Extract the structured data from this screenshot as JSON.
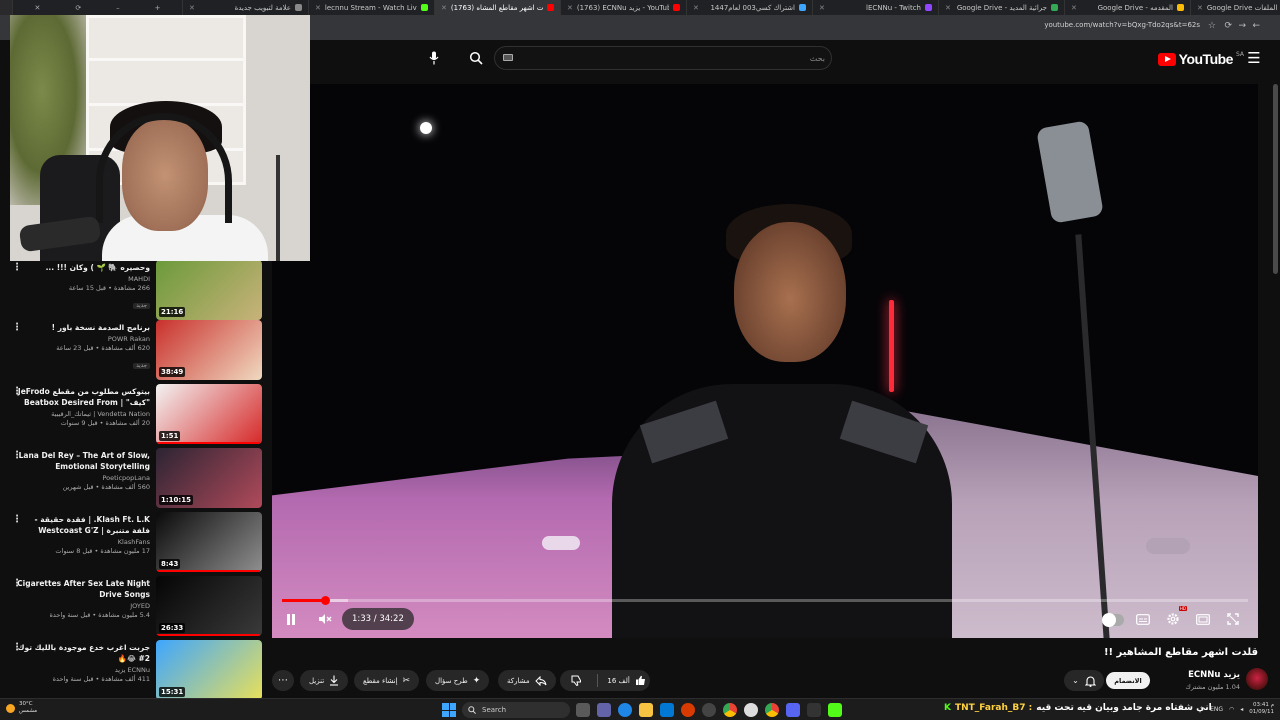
{
  "browser": {
    "tabs": [
      {
        "label": "علامة لتبويب جديدة",
        "color": "#888888"
      },
      {
        "label": "lecnnu Stream - Watch Live on",
        "color": "#53fc18"
      },
      {
        "label": "(1763) قلدت اشهر مقاطع المشاه",
        "color": "#ff0000",
        "active": true
      },
      {
        "label": "(1763) ECNNu يزيد - YouTube",
        "color": "#ff0000"
      },
      {
        "label": "اشتراك كسي003 لعام1447",
        "color": "#3ea6ff"
      },
      {
        "label": "lECNNu - Twitch",
        "color": "#9146ff"
      },
      {
        "label": "Google Drive - جرائية المديد",
        "color": "#34a853"
      },
      {
        "label": "Google Drive - المقدمه",
        "color": "#fbbc04"
      },
      {
        "label": "Google Drive مشاركة الملفات",
        "color": "#4285f4"
      }
    ],
    "url": "youtube.com/watch?v=bQxg-Tdo2qs&t=62s"
  },
  "header": {
    "logo_text": "YouTube",
    "logo_region": "SA",
    "search_placeholder": "بحث"
  },
  "player": {
    "current_time": "1:33",
    "duration": "34:22",
    "time_display": "1:33 / 34:22",
    "progress_fraction": 0.045,
    "buffered_fraction": 0.068
  },
  "video": {
    "title": "قلدت اشهر مقاطع المشاهير !!",
    "channel": "يزيد ECNNu",
    "subscribers": "1.04 مليون مشترك",
    "subscribe_label": "الانضمام",
    "likes": "16 ألف",
    "share_label": "مشاركة",
    "ask_label": "طرح سؤال",
    "clip_label": "إنشاء مقطع",
    "download_label": "تنزيل",
    "more_label": "⋯"
  },
  "sidebar": {
    "items": [
      {
        "title": "وحصيره 🐘 🌱 ) وكان !!! ...",
        "channel": "MAHDI",
        "stats": "266 مشاهدة • قبل 15 ساعة",
        "badge": "جديد",
        "duration": "21:16",
        "colors": [
          "#6b9a3a",
          "#c9b27a"
        ]
      },
      {
        "title": "برنامج الصدمة نسخة باور !",
        "channel": "POWR Rakan",
        "stats": "620 ألف مشاهدة • قبل 23 ساعة",
        "badge": "جديد",
        "duration": "38:49",
        "colors": [
          "#c9302c",
          "#f0d9c0"
        ]
      },
      {
        "title": "بيتوكس مطلوب من مقطع JeFrodo \"كيف\" Beatbox Desired From | #4 ...",
        "channel": "Vendetta Nation | ثيماتك_الرقيبية",
        "stats": "20 ألف مشاهدة • قبل 9 سنوات",
        "duration": "1:51",
        "colors": [
          "#f3f3f3",
          "#d62828"
        ],
        "watched": 0.98
      },
      {
        "title": "Lana Del Rey – The Art of Slow, Emotional Storytelling",
        "channel": "PoeticpopLana",
        "stats": "560 ألف مشاهدة • قبل شهرين",
        "duration": "1:10:15",
        "colors": [
          "#2c2433",
          "#b04a5a"
        ]
      },
      {
        "title": "Klash Ft. L.K. | فقدة حقيقة - فلفة متنبرة | Westcoast G'Z",
        "channel": "KlashFans",
        "stats": "17 مليون مشاهدة • قبل 8 سنوات",
        "duration": "8:43",
        "colors": [
          "#0a0a0a",
          "#8f8f8f"
        ],
        "watched": 0.98
      },
      {
        "title": "Cigarettes After Sex Late Night Drive Songs",
        "channel": "JOYED",
        "stats": "5.4 مليون مشاهدة • قبل سنة واحدة",
        "duration": "26:33",
        "colors": [
          "#050505",
          "#3a3a3a"
        ],
        "watched": 0.98
      },
      {
        "title": "جربت اغرب خدع موجودة بالليك توك 2# 😂🔥",
        "channel": "ECNNu يزيد",
        "stats": "411 ألف مشاهدة • قبل سنة واحدة",
        "duration": "15:31",
        "colors": [
          "#3ea6ff",
          "#e8e05a"
        ]
      }
    ]
  },
  "taskbar": {
    "weather_temp": "30°C",
    "weather_desc": "مشمس",
    "search_label": "Search",
    "ticker_user": "TNT_Farah_B7 :",
    "ticker_text": "اني شفتاه مرة جامد وبيان قيه تحت قيه",
    "lang": "ENG",
    "time": "03:41 م",
    "date": "01/09/11"
  }
}
